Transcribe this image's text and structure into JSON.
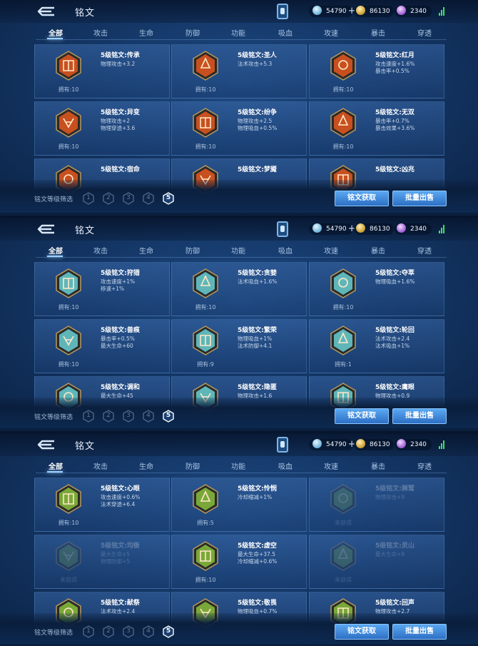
{
  "header": {
    "title": "铭文",
    "currency_gem": "54790",
    "currency_gold": "86130",
    "currency_diamond": "2340"
  },
  "tabs": [
    "全部",
    "攻击",
    "生命",
    "防御",
    "功能",
    "吸血",
    "攻速",
    "暴击",
    "穿透"
  ],
  "footer": {
    "filter_label": "铭文等级筛选",
    "levels": [
      "1",
      "2",
      "3",
      "4",
      "5"
    ],
    "active_level": "5",
    "get_button": "铭文获取",
    "sell_button": "批量出售"
  },
  "colors": {
    "red": "#c8501f",
    "cyan": "#5fb6b9",
    "green": "#7aa838"
  },
  "screens": [
    {
      "color": "red",
      "cards": [
        {
          "name": "5级铭文:传承",
          "stats": [
            "物理攻击+3.2"
          ],
          "owned": "拥有:10"
        },
        {
          "name": "5级铭文:圣人",
          "stats": [
            "法术攻击+5.3"
          ],
          "owned": "拥有:10"
        },
        {
          "name": "5级铭文:红月",
          "stats": [
            "攻击速度+1.6%",
            "暴击率+0.5%"
          ],
          "owned": "拥有:10"
        },
        {
          "name": "5级铭文:异变",
          "stats": [
            "物理攻击+2",
            "物理穿透+3.6"
          ],
          "owned": "拥有:10"
        },
        {
          "name": "5级铭文:纷争",
          "stats": [
            "物理攻击+2.5",
            "物理吸血+0.5%"
          ],
          "owned": "拥有:10"
        },
        {
          "name": "5级铭文:无双",
          "stats": [
            "暴击率+0.7%",
            "暴击效果+3.6%"
          ],
          "owned": "拥有:10"
        },
        {
          "name": "5级铭文:宿命",
          "stats": [],
          "owned": ""
        },
        {
          "name": "5级铭文:梦魇",
          "stats": [],
          "owned": ""
        },
        {
          "name": "5级铭文:凶兆",
          "stats": [],
          "owned": ""
        }
      ]
    },
    {
      "color": "cyan",
      "cards": [
        {
          "name": "5级铭文:狩猎",
          "stats": [
            "攻击速度+1%",
            "移速+1%"
          ],
          "owned": "拥有:10"
        },
        {
          "name": "5级铭文:贪婪",
          "stats": [
            "法术吸血+1.6%"
          ],
          "owned": "拥有:10"
        },
        {
          "name": "5级铭文:夺萃",
          "stats": [
            "物理吸血+1.6%"
          ],
          "owned": "拥有:10"
        },
        {
          "name": "5级铭文:兽痕",
          "stats": [
            "暴击率+0.5%",
            "最大生命+60"
          ],
          "owned": "拥有:10"
        },
        {
          "name": "5级铭文:繁荣",
          "stats": [
            "物理吸血+1%",
            "法术防御+4.1"
          ],
          "owned": "拥有:9"
        },
        {
          "name": "5级铭文:轮回",
          "stats": [
            "法术攻击+2.4",
            "法术吸血+1%"
          ],
          "owned": "拥有:1"
        },
        {
          "name": "5级铭文:调和",
          "stats": [
            "最大生命+45"
          ],
          "owned": ""
        },
        {
          "name": "5级铭文:隐匿",
          "stats": [
            "物理攻击+1.6"
          ],
          "owned": ""
        },
        {
          "name": "5级铭文:鹰眼",
          "stats": [
            "物理攻击+0.9"
          ],
          "owned": ""
        }
      ]
    },
    {
      "color": "green",
      "cards": [
        {
          "name": "5级铭文:心眼",
          "stats": [
            "攻击速度+0.6%",
            "法术穿透+6.4"
          ],
          "owned": "拥有:10",
          "dim": false
        },
        {
          "name": "5级铭文:怜悯",
          "stats": [
            "冷却缩减+1%"
          ],
          "owned": "拥有:5",
          "dim": false
        },
        {
          "name": "5级铭文:狮鹫",
          "stats": [
            "物理攻击+9"
          ],
          "owned": "未获得",
          "dim": true
        },
        {
          "name": "5级铭文:均衡",
          "stats": [
            "最大生命+5",
            "物理防御+5"
          ],
          "owned": "未获得",
          "dim": true
        },
        {
          "name": "5级铭文:虚空",
          "stats": [
            "最大生命+37.5",
            "冷却缩减+0.6%"
          ],
          "owned": "拥有:10",
          "dim": false
        },
        {
          "name": "5级铭文:灵山",
          "stats": [
            "最大生命+9"
          ],
          "owned": "未获得",
          "dim": true
        },
        {
          "name": "5级铭文:献祭",
          "stats": [
            "法术攻击+2.4"
          ],
          "owned": "",
          "dim": false
        },
        {
          "name": "5级铭文:敬畏",
          "stats": [
            "物理吸血+0.7%"
          ],
          "owned": "",
          "dim": false
        },
        {
          "name": "5级铭文:回声",
          "stats": [
            "物理攻击+2.7"
          ],
          "owned": "",
          "dim": false
        }
      ]
    }
  ]
}
